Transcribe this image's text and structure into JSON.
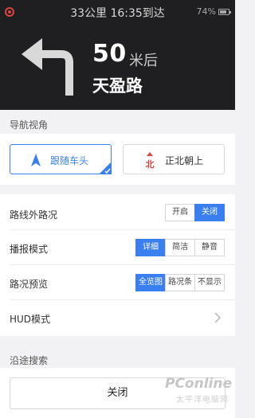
{
  "status": {
    "trip_summary": "33公里  16:35到达",
    "battery": "74%"
  },
  "guidance": {
    "distance": "50",
    "distance_unit": "米后",
    "road_name": "天盈路",
    "maneuver_icon": "turn-left-arrow-icon"
  },
  "nav_view": {
    "section_title": "导航视角",
    "options": [
      {
        "label": "跟随车头",
        "icon": "navigation-arrow-icon",
        "selected": true
      },
      {
        "label": "正北朝上",
        "icon": "north-up-icon",
        "selected": false
      }
    ]
  },
  "settings": {
    "traffic_outside": {
      "label": "路线外路况",
      "options": [
        "开启",
        "关闭"
      ],
      "selected": "关闭"
    },
    "broadcast_mode": {
      "label": "播报模式",
      "options": [
        "详细",
        "简洁",
        "静音"
      ],
      "selected": "详细"
    },
    "traffic_preview": {
      "label": "路况预览",
      "options": [
        "全览图",
        "路况条",
        "不显示"
      ],
      "selected": "全览图"
    },
    "hud_mode": {
      "label": "HUD模式"
    }
  },
  "along_route": {
    "section_title": "沿途搜索"
  },
  "close_label": "关闭",
  "watermark": {
    "brand": "PConline",
    "sub": "太平洋电脑网"
  },
  "colors": {
    "accent": "#3a7ff0",
    "header_bg": "#1f1f21",
    "north_red": "#d8453a"
  }
}
